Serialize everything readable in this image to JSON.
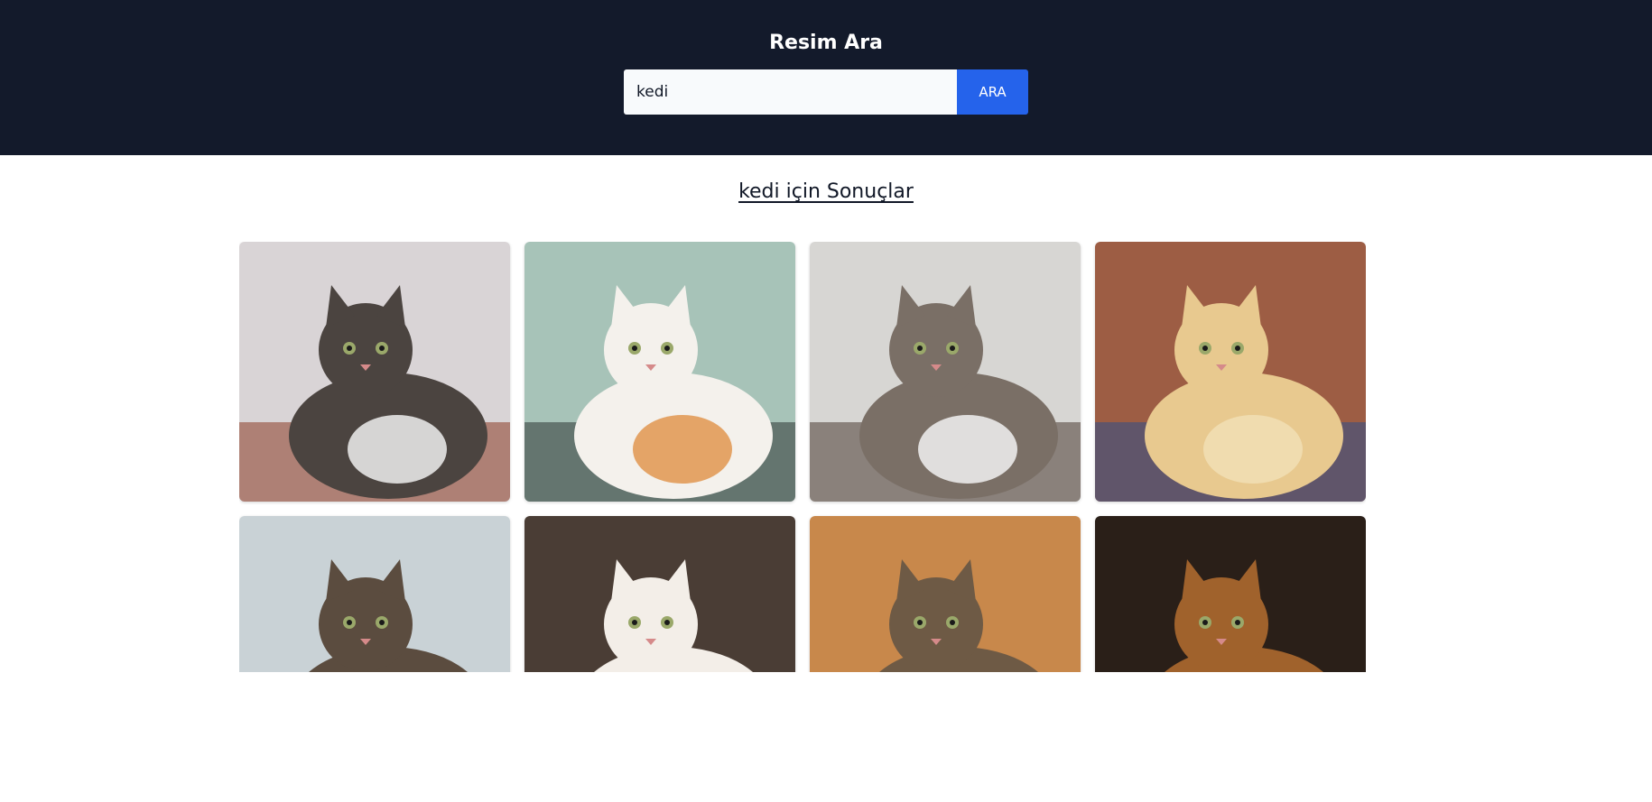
{
  "header": {
    "title": "Resim Ara",
    "search_value": "kedi",
    "search_button": "ARA"
  },
  "results": {
    "heading": "kedi için Sonuçlar",
    "items": [
      {
        "bg": "#d9d4d6",
        "accent": "#8a3a26",
        "subject": "#4b4440",
        "belly": "#efefef"
      },
      {
        "bg": "#a7c3b8",
        "accent": "#2d3433",
        "subject": "#f4f1ec",
        "belly": "#e09650"
      },
      {
        "bg": "#d7d6d3",
        "accent": "#4a3d33",
        "subject": "#7a6f66",
        "belly": "#f2f2f2"
      },
      {
        "bg": "#9d5d44",
        "accent": "#2d4f8a",
        "subject": "#e8c98f",
        "belly": "#f1dfb5"
      },
      {
        "bg": "#c9d2d6",
        "accent": "#8e8c8a",
        "subject": "#5b4c3f",
        "belly": "#7c6a5a"
      },
      {
        "bg": "#4a3d35",
        "accent": "#6d5d52",
        "subject": "#f3eee8",
        "belly": "#d98a3c"
      },
      {
        "bg": "#c8884b",
        "accent": "#3a2a1f",
        "subject": "#6e5a45",
        "belly": "#d8cfc0"
      },
      {
        "bg": "#2a1f18",
        "accent": "#d9a06a",
        "subject": "#a0622c",
        "belly": "#f7e1c0"
      }
    ]
  }
}
